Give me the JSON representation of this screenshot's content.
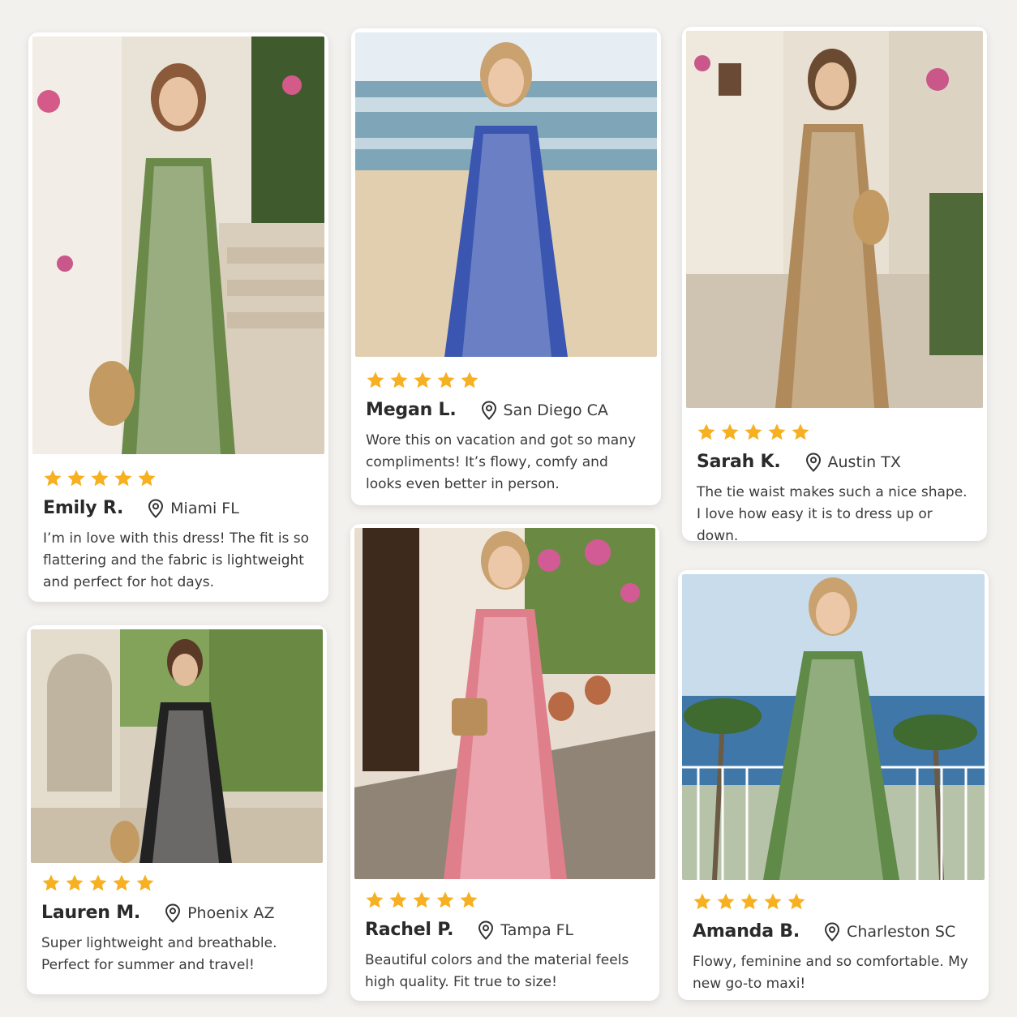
{
  "colors": {
    "star": "#f6b021",
    "background": "#f3f1ee",
    "card": "#ffffff",
    "text": "#2b2b2b"
  },
  "icons": {
    "star": "star-icon",
    "location": "location-pin-icon"
  },
  "reviews": [
    {
      "rating": 5,
      "name": "Emily R.",
      "location": "Miami FL",
      "text": "I’m in love with this dress! The fit is so flattering and the fabric is lightweight and perfect for hot days.",
      "dress_color": "#6b8a4a"
    },
    {
      "rating": 5,
      "name": "Megan L.",
      "location": "San Diego CA",
      "text": "Wore this on vacation and got so many compliments! It’s flowy, comfy and looks even better in person.",
      "dress_color": "#3a56b0"
    },
    {
      "rating": 5,
      "name": "Sarah K.",
      "location": "Austin TX",
      "text": "The tie waist makes such a nice shape. I love how easy it is to dress up or down.",
      "dress_color": "#b08a5a"
    },
    {
      "rating": 5,
      "name": "Lauren M.",
      "location": "Phoenix AZ",
      "text": "Super lightweight and breathable. Perfect for summer and travel!",
      "dress_color": "#222222"
    },
    {
      "rating": 5,
      "name": "Rachel P.",
      "location": "Tampa FL",
      "text": "Beautiful colors and the material feels high quality. Fit true to size!",
      "dress_color": "#e07f8c"
    },
    {
      "rating": 5,
      "name": "Amanda B.",
      "location": "Charleston SC",
      "text": "Flowy, feminine and so comfortable. My new go-to maxi!",
      "dress_color": "#5f8a48"
    }
  ]
}
